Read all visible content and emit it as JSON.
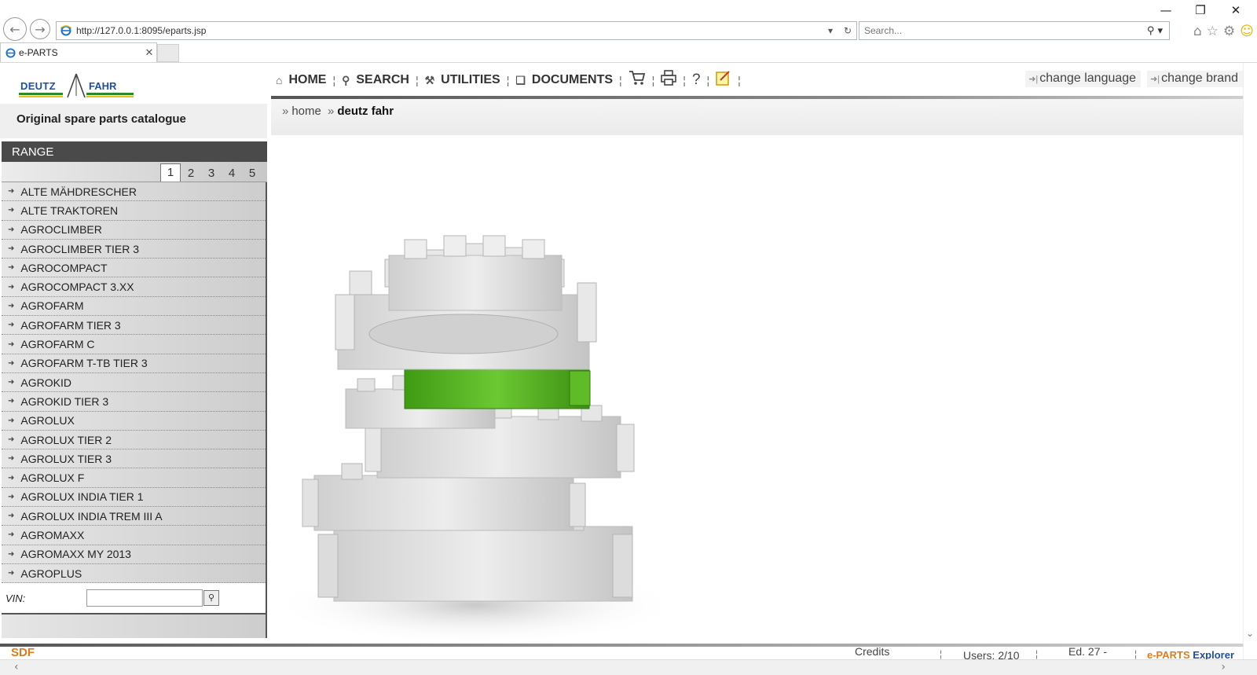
{
  "browser": {
    "url": "http://127.0.0.1:8095/eparts.jsp",
    "search_placeholder": "Search...",
    "tab_title": "e-PARTS"
  },
  "brand": {
    "logo_left": "DEUTZ",
    "logo_right": "FAHR",
    "subtitle": "Original spare parts catalogue"
  },
  "menu": {
    "home": "HOME",
    "search": "SEARCH",
    "utilities": "UTILITIES",
    "documents": "DOCUMENTS",
    "change_language": "change language",
    "change_brand": "change brand"
  },
  "breadcrumb": {
    "home": "home",
    "current": "deutz fahr"
  },
  "range": {
    "header": "RANGE",
    "pages": [
      "1",
      "2",
      "3",
      "4",
      "5"
    ],
    "active_page": "1",
    "items": [
      "ALTE MÄHDRESCHER",
      "ALTE TRAKTOREN",
      "AGROCLIMBER",
      "AGROCLIMBER TIER 3",
      "AGROCOMPACT",
      "AGROCOMPACT 3.XX",
      "AGROFARM",
      "AGROFARM TIER 3",
      "AGROFARM C",
      "AGROFARM T-TB TIER 3",
      "AGROKID",
      "AGROKID TIER 3",
      "AGROLUX",
      "AGROLUX TIER 2",
      "AGROLUX TIER 3",
      "AGROLUX F",
      "AGROLUX INDIA TIER 1",
      "AGROLUX INDIA TREM III A",
      "AGROMAXX",
      "AGROMAXX MY 2013",
      "AGROPLUS"
    ],
    "vin_label": "VIN:"
  },
  "footer": {
    "sdf": "SDF",
    "credits": "Credits",
    "users": "Users: 2/10",
    "edition": "Ed. 27 -",
    "eparts_e": "e-PARTS",
    "eparts_x": "Explorer"
  },
  "colors": {
    "accent_gear": "#4caa1e",
    "header_dark": "#4a4a4a",
    "brand_blue": "#1e4fa0"
  }
}
